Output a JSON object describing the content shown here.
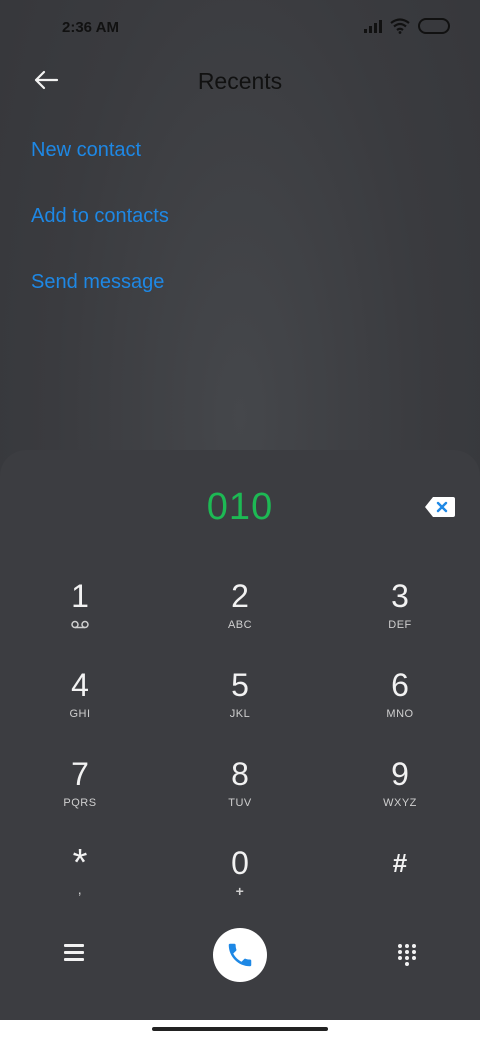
{
  "status_bar": {
    "time": "2:36 AM"
  },
  "header": {
    "title": "Recents"
  },
  "menu": {
    "items": [
      "New contact",
      "Add to contacts",
      "Send message"
    ]
  },
  "dialpad": {
    "number": "010",
    "keys": [
      {
        "digit": "1",
        "letters": ""
      },
      {
        "digit": "2",
        "letters": "ABC"
      },
      {
        "digit": "3",
        "letters": "DEF"
      },
      {
        "digit": "4",
        "letters": "GHI"
      },
      {
        "digit": "5",
        "letters": "JKL"
      },
      {
        "digit": "6",
        "letters": "MNO"
      },
      {
        "digit": "7",
        "letters": "PQRS"
      },
      {
        "digit": "8",
        "letters": "TUV"
      },
      {
        "digit": "9",
        "letters": "WXYZ"
      },
      {
        "digit": "*",
        "letters": ","
      },
      {
        "digit": "0",
        "letters": "+"
      },
      {
        "digit": "#",
        "letters": ""
      }
    ]
  },
  "colors": {
    "accent": "#1e88e5",
    "number": "#1db954",
    "call": "#1e88e5"
  },
  "icons": {
    "back": "back-arrow-icon",
    "backspace": "backspace-icon",
    "voicemail": "voicemail-icon",
    "menu": "menu-icon",
    "call": "phone-icon",
    "dialpad": "dialpad-icon"
  }
}
